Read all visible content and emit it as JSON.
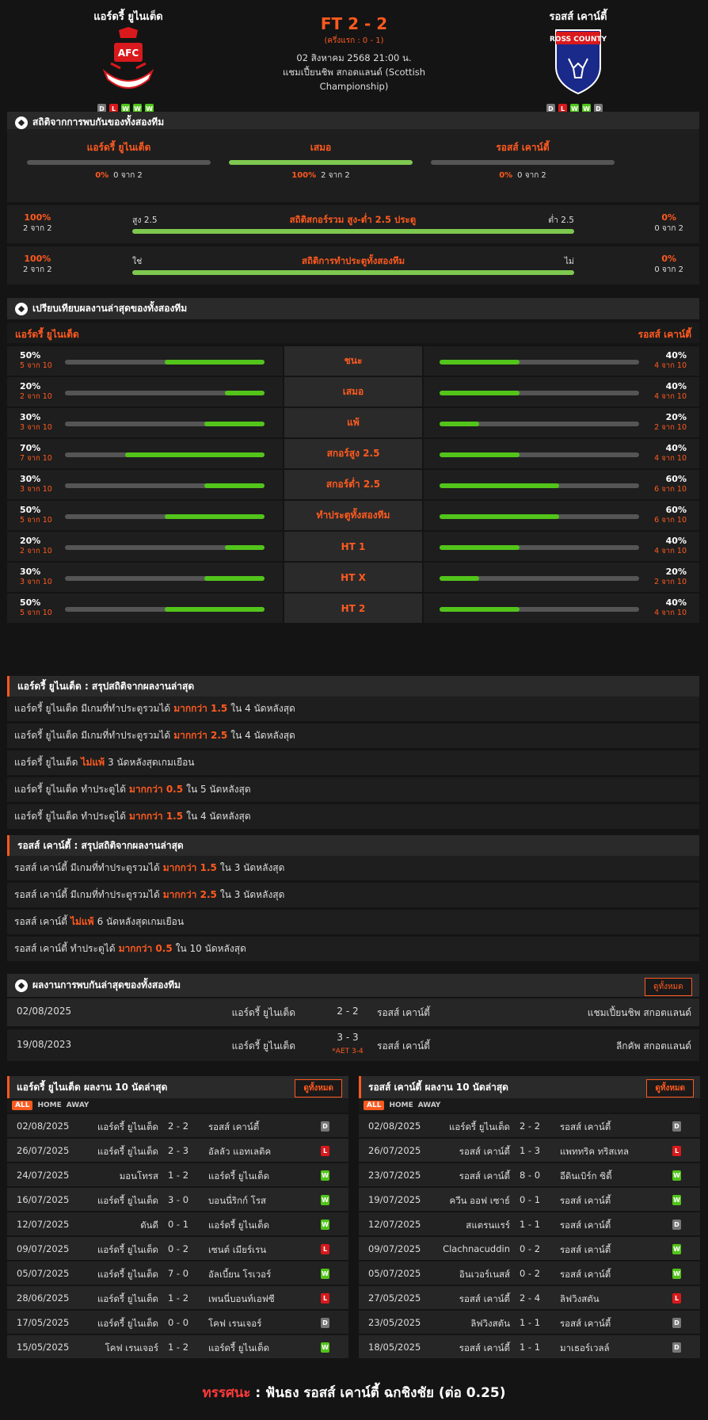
{
  "match": {
    "home_name": "แอร์ดรี้ ยูไนเต็ด",
    "away_name": "รอสส์ เคาน์ตี้",
    "score": "FT 2 - 2",
    "halftime": "(ครึ่งแรก : 0 - 1)",
    "date": "02 สิงหาคม 2568 21:00 น.",
    "competition": "แชมเปี้ยนชิพ สกอตแลนด์ (Scottish Championship)",
    "home_form": [
      "D",
      "L",
      "W",
      "W",
      "W"
    ],
    "away_form": [
      "D",
      "L",
      "W",
      "W",
      "D"
    ],
    "home_crest_text": "AFC",
    "away_crest_text": "ROSS COUNTY"
  },
  "h2h_stats": {
    "title": "สถิติจากการพบกันของทั้งสองทีม",
    "cols": [
      {
        "label": "แอร์ดรี้ ยูไนเต็ด",
        "pct": "0%",
        "count": "0 จาก 2",
        "value": 0
      },
      {
        "label": "เสมอ",
        "pct": "100%",
        "count": "2 จาก 2",
        "value": 1
      },
      {
        "label": "รอสส์ เคาน์ตี้",
        "pct": "0%",
        "count": "0 จาก 2",
        "value": 0
      }
    ],
    "ou": {
      "left_pct": "100%",
      "left_count": "2 จาก 2",
      "left_label": "สูง 2.5",
      "title": "สถิติสกอร์รวม สูง-ต่ำ 2.5 ประตู",
      "right_label": "ต่ำ 2.5",
      "right_pct": "0%",
      "right_count": "0 จาก 2"
    },
    "btts": {
      "left_pct": "100%",
      "left_count": "2 จาก 2",
      "left_label": "ใช่",
      "title": "สถิติการทำประตูทั้งสองทีม",
      "right_label": "ไม่",
      "right_pct": "0%",
      "right_count": "0 จาก 2"
    }
  },
  "compare": {
    "title": "เปรียบเทียบผลงานล่าสุดของทั้งสองทีม",
    "home": "แอร์ดรี้ ยูไนเต็ด",
    "away": "รอสส์ เคาน์ตี้",
    "rows": [
      {
        "label": "ชนะ",
        "h_pct": "50%",
        "h_cnt": "5 จาก 10",
        "h_val": 0.5,
        "a_pct": "40%",
        "a_cnt": "4 จาก 10",
        "a_val": 0.4
      },
      {
        "label": "เสมอ",
        "h_pct": "20%",
        "h_cnt": "2 จาก 10",
        "h_val": 0.2,
        "a_pct": "40%",
        "a_cnt": "4 จาก 10",
        "a_val": 0.4
      },
      {
        "label": "แพ้",
        "h_pct": "30%",
        "h_cnt": "3 จาก 10",
        "h_val": 0.3,
        "a_pct": "20%",
        "a_cnt": "2 จาก 10",
        "a_val": 0.2
      },
      {
        "label": "สกอร์สูง 2.5",
        "h_pct": "70%",
        "h_cnt": "7 จาก 10",
        "h_val": 0.7,
        "a_pct": "40%",
        "a_cnt": "4 จาก 10",
        "a_val": 0.4
      },
      {
        "label": "สกอร์ต่ำ 2.5",
        "h_pct": "30%",
        "h_cnt": "3 จาก 10",
        "h_val": 0.3,
        "a_pct": "60%",
        "a_cnt": "6 จาก 10",
        "a_val": 0.6
      },
      {
        "label": "ทำประตูทั้งสองทีม",
        "h_pct": "50%",
        "h_cnt": "5 จาก 10",
        "h_val": 0.5,
        "a_pct": "60%",
        "a_cnt": "6 จาก 10",
        "a_val": 0.6
      },
      {
        "label": "HT 1",
        "h_pct": "20%",
        "h_cnt": "2 จาก 10",
        "h_val": 0.2,
        "a_pct": "40%",
        "a_cnt": "4 จาก 10",
        "a_val": 0.4
      },
      {
        "label": "HT X",
        "h_pct": "30%",
        "h_cnt": "3 จาก 10",
        "h_val": 0.3,
        "a_pct": "20%",
        "a_cnt": "2 จาก 10",
        "a_val": 0.2
      },
      {
        "label": "HT 2",
        "h_pct": "50%",
        "h_cnt": "5 จาก 10",
        "h_val": 0.5,
        "a_pct": "40%",
        "a_cnt": "4 จาก 10",
        "a_val": 0.4
      }
    ]
  },
  "home_summary": {
    "title": "แอร์ดรี้ ยูไนเต็ด : สรุปสถิติจากผลงานล่าสุด",
    "rows": [
      {
        "pre": "แอร์ดรี้ ยูไนเต็ด มีเกมที่ทำประตูรวมได้",
        "hl": "มากกว่า 1.5",
        "post": "ใน 4 นัดหลังสุด"
      },
      {
        "pre": "แอร์ดรี้ ยูไนเต็ด มีเกมที่ทำประตูรวมได้",
        "hl": "มากกว่า 2.5",
        "post": "ใน 4 นัดหลังสุด"
      },
      {
        "pre": "แอร์ดรี้ ยูไนเต็ด",
        "hl": "ไม่แพ้",
        "post": "3 นัดหลังสุดเกมเยือน"
      },
      {
        "pre": "แอร์ดรี้ ยูไนเต็ด ทำประตูได้",
        "hl": "มากกว่า 0.5",
        "post": "ใน 5 นัดหลังสุด"
      },
      {
        "pre": "แอร์ดรี้ ยูไนเต็ด ทำประตูได้",
        "hl": "มากกว่า 1.5",
        "post": "ใน 4 นัดหลังสุด"
      }
    ]
  },
  "away_summary": {
    "title": "รอสส์ เคาน์ตี้ : สรุปสถิติจากผลงานล่าสุด",
    "rows": [
      {
        "pre": "รอสส์ เคาน์ตี้ มีเกมที่ทำประตูรวมได้",
        "hl": "มากกว่า 1.5",
        "post": "ใน 3 นัดหลังสุด"
      },
      {
        "pre": "รอสส์ เคาน์ตี้ มีเกมที่ทำประตูรวมได้",
        "hl": "มากกว่า 2.5",
        "post": "ใน 3 นัดหลังสุด"
      },
      {
        "pre": "รอสส์ เคาน์ตี้",
        "hl": "ไม่แพ้",
        "post": "6 นัดหลังสุดเกมเยือน"
      },
      {
        "pre": "รอสส์ เคาน์ตี้ ทำประตูได้",
        "hl": "มากกว่า 0.5",
        "post": "ใน 10 นัดหลังสุด"
      }
    ]
  },
  "h2h_results": {
    "title": "ผลงานการพบกันล่าสุดของทั้งสองทีม",
    "view_all": "ดูทั้งหมด",
    "rows": [
      {
        "date": "02/08/2025",
        "home": "แอร์ดรี้ ยูไนเต็ด",
        "score": "2 - 2",
        "away": "รอสส์ เคาน์ตี้",
        "comp": "แชมเปี้ยนชิพ สกอตแลนด์",
        "note": ""
      },
      {
        "date": "19/08/2023",
        "home": "แอร์ดรี้ ยูไนเต็ด",
        "score": "3 - 3",
        "away": "รอสส์ เคาน์ตี้",
        "comp": "ลีกคัพ สกอตแลนด์",
        "note": "*AET 3-4"
      }
    ]
  },
  "home_last10": {
    "title": "แอร์ดรี้ ยูไนเต็ด ผลงาน 10 นัดล่าสุด",
    "view_all": "ดูทั้งหมด",
    "tabs": [
      "ALL",
      "HOME",
      "AWAY"
    ],
    "rows": [
      {
        "date": "02/08/2025",
        "home": "แอร์ดรี้ ยูไนเต็ด",
        "score": "2 - 2",
        "away": "รอสส์ เคาน์ตี้",
        "res": "D"
      },
      {
        "date": "26/07/2025",
        "home": "แอร์ดรี้ ยูไนเต็ด",
        "score": "2 - 3",
        "away": "อัลลัว แอทเลติค",
        "res": "L"
      },
      {
        "date": "24/07/2025",
        "home": "มอนโทรส",
        "score": "1 - 2",
        "away": "แอร์ดรี้ ยูไนเต็ด",
        "res": "W"
      },
      {
        "date": "16/07/2025",
        "home": "แอร์ดรี้ ยูไนเต็ด",
        "score": "3 - 0",
        "away": "บอนนี่ริกก์ โรส",
        "res": "W"
      },
      {
        "date": "12/07/2025",
        "home": "ดันดี",
        "score": "0 - 1",
        "away": "แอร์ดรี้ ยูไนเต็ด",
        "res": "W"
      },
      {
        "date": "09/07/2025",
        "home": "แอร์ดรี้ ยูไนเต็ด",
        "score": "0 - 2",
        "away": "เซนต์ เมียร์เรน",
        "res": "L"
      },
      {
        "date": "05/07/2025",
        "home": "แอร์ดรี้ ยูไนเต็ด",
        "score": "7 - 0",
        "away": "อัลเบี้ยน โรเวอร์",
        "res": "W"
      },
      {
        "date": "28/06/2025",
        "home": "แอร์ดรี้ ยูไนเต็ด",
        "score": "1 - 2",
        "away": "เพนนี่บอนท์เอฟซี",
        "res": "L"
      },
      {
        "date": "17/05/2025",
        "home": "แอร์ดรี้ ยูไนเต็ด",
        "score": "0 - 0",
        "away": "โคฟ เรนเจอร์",
        "res": "D"
      },
      {
        "date": "15/05/2025",
        "home": "โคฟ เรนเจอร์",
        "score": "1 - 2",
        "away": "แอร์ดรี้ ยูไนเต็ด",
        "res": "W"
      }
    ]
  },
  "away_last10": {
    "title": "รอสส์ เคาน์ตี้ ผลงาน 10 นัดล่าสุด",
    "view_all": "ดูทั้งหมด",
    "tabs": [
      "ALL",
      "HOME",
      "AWAY"
    ],
    "rows": [
      {
        "date": "02/08/2025",
        "home": "แอร์ดรี้ ยูไนเต็ด",
        "score": "2 - 2",
        "away": "รอสส์ เคาน์ตี้",
        "res": "D"
      },
      {
        "date": "26/07/2025",
        "home": "รอสส์ เคาน์ตี้",
        "score": "1 - 3",
        "away": "แพททริค ทริสเทล",
        "res": "L"
      },
      {
        "date": "23/07/2025",
        "home": "รอสส์ เคาน์ตี้",
        "score": "8 - 0",
        "away": "อีดินเบิร์ก ซิตี้",
        "res": "W"
      },
      {
        "date": "19/07/2025",
        "home": "ควีน ออฟ เซาธ์",
        "score": "0 - 1",
        "away": "รอสส์ เคาน์ตี้",
        "res": "W"
      },
      {
        "date": "12/07/2025",
        "home": "สแตรนแรร์",
        "score": "1 - 1",
        "away": "รอสส์ เคาน์ตี้",
        "res": "D"
      },
      {
        "date": "09/07/2025",
        "home": "Clachnacuddin",
        "score": "0 - 2",
        "away": "รอสส์ เคาน์ตี้",
        "res": "W"
      },
      {
        "date": "05/07/2025",
        "home": "อินเวอร์เนสส์",
        "score": "0 - 2",
        "away": "รอสส์ เคาน์ตี้",
        "res": "W"
      },
      {
        "date": "27/05/2025",
        "home": "รอสส์ เคาน์ตี้",
        "score": "2 - 4",
        "away": "ลิฟวิงสตัน",
        "res": "L"
      },
      {
        "date": "23/05/2025",
        "home": "ลิฟวิงสตัน",
        "score": "1 - 1",
        "away": "รอสส์ เคาน์ตี้",
        "res": "D"
      },
      {
        "date": "18/05/2025",
        "home": "รอสส์ เคาน์ตี้",
        "score": "1 - 1",
        "away": "มาเธอร์เวลล์",
        "res": "D"
      }
    ]
  },
  "verdict": {
    "label": "ทรรศนะ",
    "sep": ":",
    "text": "ฟันธง รอสส์ เคาน์ตี้ ฉกชิงชัย (ต่อ 0.25)"
  }
}
